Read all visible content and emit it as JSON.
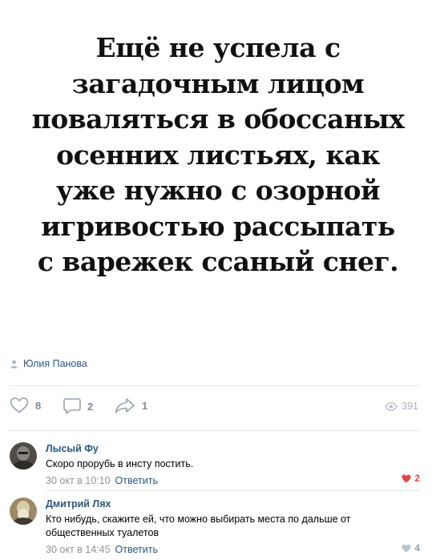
{
  "post": {
    "quote": "Ещё не успела с\nзагадочным лицом\nповаляться в обоссаных\nосенних листьях, как\nуже нужно с озорной\nигривостью рассыпать\nс варежек ссаный снег.",
    "author": "Юлия Панова",
    "likes": "8",
    "comments": "2",
    "shares": "1",
    "views": "391"
  },
  "comments": [
    {
      "author": "Лысый Фу",
      "text": "Скоро прорубь в инсту постить.",
      "date": "30 окт в 10:10",
      "reply": "Ответить",
      "likes": "2",
      "liked": true
    },
    {
      "author": "Дмитрий Лях",
      "text": "Кто нибудь, скажите ей, что можно выбирать места по дальше от общественных туалетов",
      "date": "30 окт в 14:45",
      "reply": "Ответить",
      "likes": "4",
      "liked": false
    }
  ],
  "icons": {
    "author": "person-icon",
    "like": "heart-outline-icon",
    "comment": "comment-bubble-icon",
    "share": "share-arrow-icon",
    "views": "eye-icon",
    "comment_like_active": "heart-filled-icon",
    "comment_like": "heart-filled-icon"
  },
  "colors": {
    "link": "#2a5885",
    "muted": "#828a99",
    "like_active": "#e64646",
    "divider": "#e7e8ec"
  }
}
